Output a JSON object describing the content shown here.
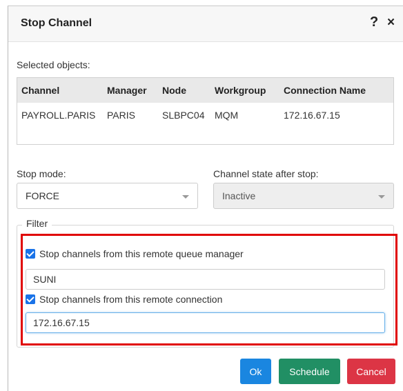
{
  "dialog": {
    "title": "Stop Channel",
    "help_icon": "?",
    "close_icon": "×"
  },
  "selected_label": "Selected objects:",
  "table": {
    "columns": [
      "Channel",
      "Manager",
      "Node",
      "Workgroup",
      "Connection Name"
    ],
    "rows": [
      [
        "PAYROLL.PARIS",
        "PARIS",
        "SLBPC04",
        "MQM",
        "172.16.67.15"
      ]
    ]
  },
  "stop_mode": {
    "label": "Stop mode:",
    "value": "FORCE"
  },
  "channel_state": {
    "label": "Channel state after stop:",
    "value": "Inactive",
    "disabled": true
  },
  "filter": {
    "legend": "Filter",
    "remote_qmgr": {
      "label": "Stop channels from this remote queue manager",
      "checked": true,
      "value": "SUNI"
    },
    "remote_conn": {
      "label": "Stop channels from this remote connection",
      "checked": true,
      "value": "172.16.67.15"
    }
  },
  "buttons": {
    "ok": "Ok",
    "schedule": "Schedule",
    "cancel": "Cancel"
  },
  "colors": {
    "ok": "#1a86e0",
    "schedule": "#218f64",
    "cancel": "#dc3545",
    "highlight": "#e00000",
    "checkbox": "#1a73e8"
  }
}
